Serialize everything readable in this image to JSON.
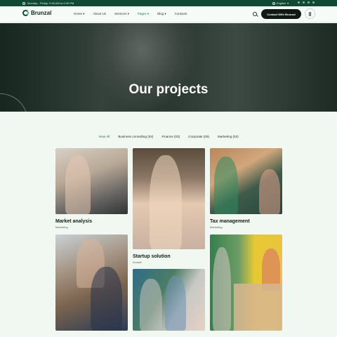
{
  "topbar": {
    "hours": "Monday - Friday: 9:30 AM to 6:30 PM",
    "language": "English",
    "social_icons": [
      "facebook-icon",
      "twitter-icon",
      "vimeo-icon",
      "linkedin-icon"
    ]
  },
  "header": {
    "logo": "Brunzal",
    "nav": [
      "Home",
      "About Us",
      "Services",
      "Pages",
      "Blog",
      "Contacts"
    ],
    "active_nav": "Pages",
    "cta": "Contact With Brunzal"
  },
  "hero": {
    "title": "Our projects"
  },
  "filters": {
    "items": [
      "View All",
      "Business consulting (04)",
      "Finance (03)",
      "Corporate (05)",
      "Marketing (02)"
    ],
    "active": "View All"
  },
  "projects": [
    {
      "title": "Market analysis",
      "category": "Marketing"
    },
    {
      "title": "Startup solution",
      "category": "Growth"
    },
    {
      "title": "Tax management",
      "category": "Marketing"
    },
    {
      "title": "",
      "category": ""
    },
    {
      "title": "",
      "category": ""
    },
    {
      "title": "",
      "category": ""
    }
  ],
  "colors": {
    "brand": "#104a34",
    "accent": "#1e7a4f",
    "background": "#f1f7f1"
  }
}
